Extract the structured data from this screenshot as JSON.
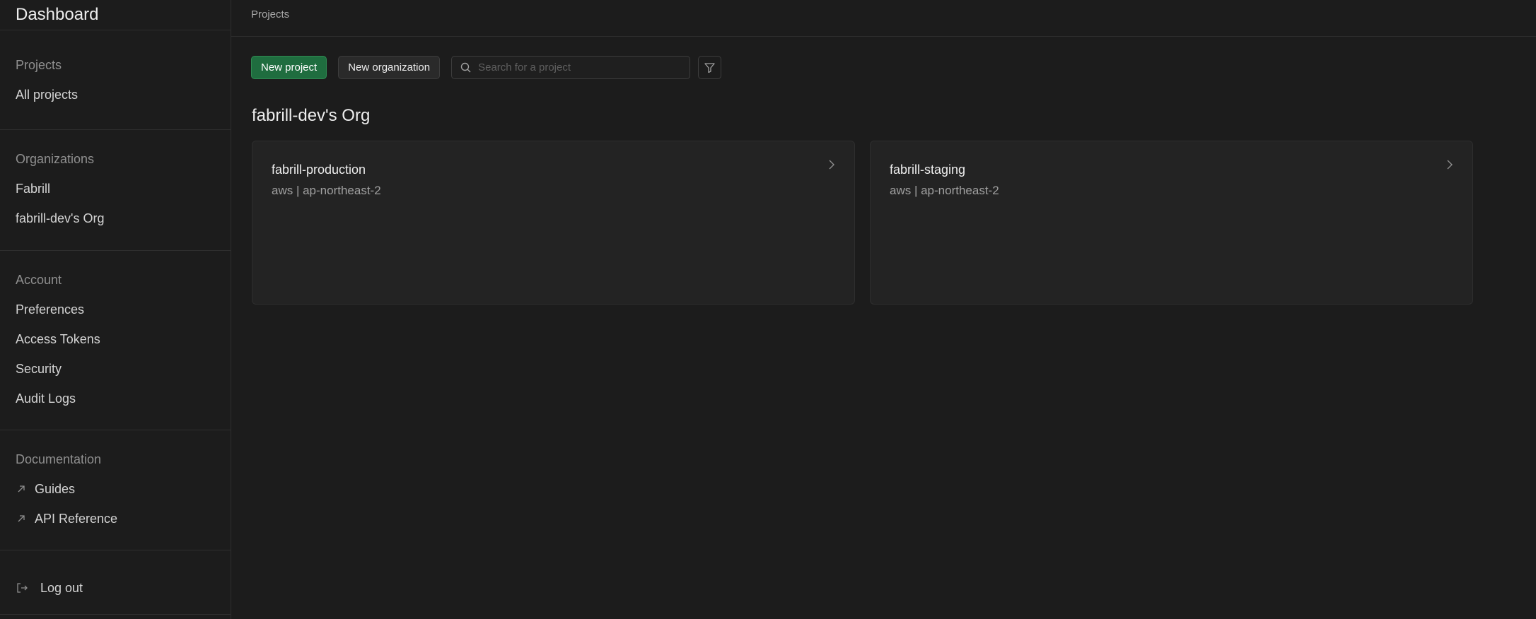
{
  "sidebar": {
    "brand": "Dashboard",
    "sections": {
      "projects": {
        "heading": "Projects",
        "items": [
          "All projects"
        ]
      },
      "organizations": {
        "heading": "Organizations",
        "items": [
          "Fabrill",
          "fabrill-dev's Org"
        ]
      },
      "account": {
        "heading": "Account",
        "items": [
          "Preferences",
          "Access Tokens",
          "Security",
          "Audit Logs"
        ]
      },
      "documentation": {
        "heading": "Documentation",
        "items": [
          "Guides",
          "API Reference"
        ]
      },
      "logout": "Log out"
    }
  },
  "header": {
    "breadcrumb": "Projects"
  },
  "toolbar": {
    "new_project": "New project",
    "new_organization": "New organization",
    "search_placeholder": "Search for a project"
  },
  "org": {
    "title": "fabrill-dev's Org",
    "projects": [
      {
        "name": "fabrill-production",
        "meta": "aws | ap-northeast-2"
      },
      {
        "name": "fabrill-staging",
        "meta": "aws | ap-northeast-2"
      }
    ]
  },
  "colors": {
    "background": "#1c1c1c",
    "primary_button": "#1f6d3f",
    "card": "#232323",
    "border": "#2e2e2e"
  },
  "icons": [
    "search-icon",
    "filter-icon",
    "chevron-right-icon",
    "external-link-icon",
    "logout-icon"
  ]
}
